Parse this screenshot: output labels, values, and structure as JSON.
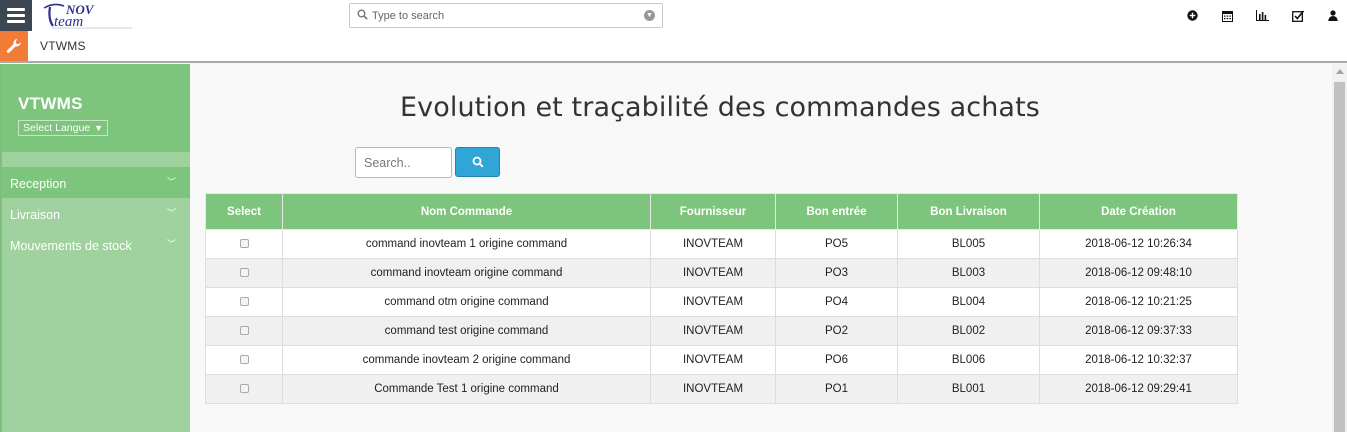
{
  "topbar": {
    "logo_icon": "inovteam-logo",
    "search_placeholder": "Type to search",
    "icons": [
      "plus-circle-icon",
      "calendar-icon",
      "bar-chart-icon",
      "checkbox-icon",
      "user-icon"
    ]
  },
  "subbar": {
    "title": "VTWMS"
  },
  "sidebar": {
    "title": "VTWMS",
    "lang_select": "Select Langue",
    "items": [
      {
        "label": "Reception"
      },
      {
        "label": "Livraison"
      },
      {
        "label": "Mouvements de stock"
      }
    ]
  },
  "main": {
    "title": "Evolution et traçabilité des commandes achats",
    "search_placeholder": "Search..",
    "table": {
      "headers": [
        "Select",
        "Nom Commande",
        "Fournisseur",
        "Bon entrée",
        "Bon Livraison",
        "Date Création"
      ],
      "rows": [
        [
          "command inovteam 1 origine command",
          "INOVTEAM",
          "PO5",
          "BL005",
          "2018-06-12 10:26:34"
        ],
        [
          "command inovteam origine command",
          "INOVTEAM",
          "PO3",
          "BL003",
          "2018-06-12 09:48:10"
        ],
        [
          "command otm origine command",
          "INOVTEAM",
          "PO4",
          "BL004",
          "2018-06-12 10:21:25"
        ],
        [
          "command test origine command",
          "INOVTEAM",
          "PO2",
          "BL002",
          "2018-06-12 09:37:33"
        ],
        [
          "commande inovteam 2 origine command",
          "INOVTEAM",
          "PO6",
          "BL006",
          "2018-06-12 10:32:37"
        ],
        [
          "Commande Test 1 origine command",
          "INOVTEAM",
          "PO1",
          "BL001",
          "2018-06-12 09:29:41"
        ]
      ]
    }
  },
  "colors": {
    "sidebar_dark": "#7dc47d",
    "sidebar_light": "#9fd29f",
    "accent_orange": "#f07c38",
    "header_dark": "#3d4752",
    "button_blue": "#2fa6d6"
  }
}
